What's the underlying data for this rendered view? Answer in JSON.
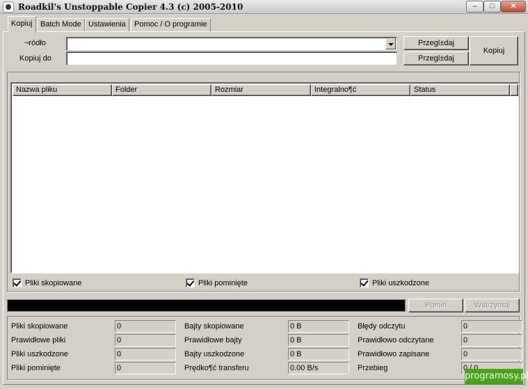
{
  "window": {
    "title": "Roadkil's Unstoppable Copier 4.3 (c) 2005-2010",
    "min_symbol": "–",
    "max_symbol": "□",
    "close_symbol": "✕"
  },
  "tabs": [
    "Kopiuj",
    "Batch Mode",
    "Ustawienia",
    "Pomoc / O programie"
  ],
  "source": {
    "label": "¬ródło",
    "value": "",
    "browse_label": "Przegl±daj"
  },
  "destination": {
    "label": "Kopiuj do",
    "value": "",
    "browse_label": "Przegl±daj"
  },
  "copy_button": "Kopiuj",
  "file_list": {
    "columns": [
      "Nazwa pliku",
      "Folder",
      "Rozmiar",
      "Integralno¶ć",
      "Status"
    ],
    "rows": []
  },
  "filters": [
    {
      "label": "Pliki skopiowane",
      "checked": true
    },
    {
      "label": "Pliki pominięte",
      "checked": true
    },
    {
      "label": "Pliki uszkodzone",
      "checked": true
    }
  ],
  "progress": {
    "skip_label": "Pomiń",
    "pause_label": "Wstrzymaj"
  },
  "stats": {
    "col1": [
      {
        "label": "Pliki skopiowane",
        "value": "0"
      },
      {
        "label": "Prawidłowe pliki",
        "value": "0"
      },
      {
        "label": "Pliki uszkodzone",
        "value": "0"
      },
      {
        "label": "Pliki pominięte",
        "value": "0"
      }
    ],
    "col2": [
      {
        "label": "Bajty skopiowane",
        "value": "0 B"
      },
      {
        "label": "Prawidłowe bajty",
        "value": "0 B"
      },
      {
        "label": "Bajty uszkodzone",
        "value": "0 B"
      },
      {
        "label": "Prędko¶ć transferu",
        "value": "0.00 B/s"
      }
    ],
    "col3": [
      {
        "label": "Błędy odczytu",
        "value": "0"
      },
      {
        "label": "Prawidłowo odczytane",
        "value": "0"
      },
      {
        "label": "Prawidłowo zapisane",
        "value": "0"
      },
      {
        "label": "Przebieg",
        "value": "0 / 0"
      }
    ]
  },
  "watermark": "programosy.pl"
}
